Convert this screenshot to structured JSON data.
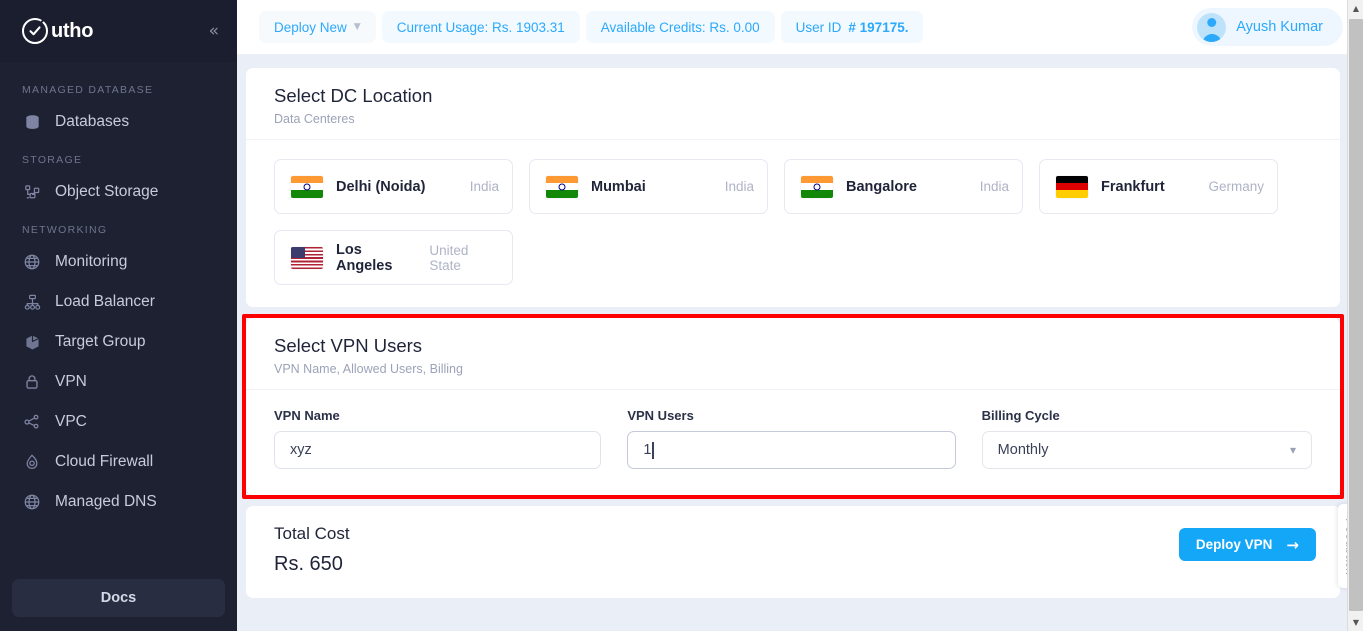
{
  "brand": {
    "name": "utho",
    "collapse_icon": "chevrons-left-icon",
    "logo_icon": "utho-check-logo"
  },
  "sidebar": {
    "groups": [
      {
        "label": "MANAGED DATABASE",
        "items": [
          {
            "label": "Databases",
            "icon": "database-icon"
          }
        ]
      },
      {
        "label": "STORAGE",
        "items": [
          {
            "label": "Object Storage",
            "icon": "object-storage-icon"
          }
        ]
      },
      {
        "label": "NETWORKING",
        "items": [
          {
            "label": "Monitoring",
            "icon": "globe-icon"
          },
          {
            "label": "Load Balancer",
            "icon": "load-balancer-icon"
          },
          {
            "label": "Target Group",
            "icon": "cube-icon"
          },
          {
            "label": "VPN",
            "icon": "lock-icon"
          },
          {
            "label": "VPC",
            "icon": "share-nodes-icon"
          },
          {
            "label": "Cloud Firewall",
            "icon": "firewall-flame-icon"
          },
          {
            "label": "Managed DNS",
            "icon": "globe-icon"
          }
        ]
      }
    ],
    "docs_label": "Docs"
  },
  "topbar": {
    "deploy_new": "Deploy New",
    "current_usage": "Current Usage: Rs. 1903.31",
    "available_credits": "Available Credits: Rs. 0.00",
    "user_id_prefix": "User ID ",
    "user_id_value": "# 197175.",
    "user_name": "Ayush Kumar",
    "accent": "#2ca9fb"
  },
  "dc_section": {
    "title": "Select DC Location",
    "subtitle": "Data Centeres",
    "locations": [
      {
        "city": "Delhi (Noida)",
        "country": "India",
        "flag": "flag-india"
      },
      {
        "city": "Mumbai",
        "country": "India",
        "flag": "flag-india"
      },
      {
        "city": "Bangalore",
        "country": "India",
        "flag": "flag-india"
      },
      {
        "city": "Frankfurt",
        "country": "Germany",
        "flag": "flag-germany"
      },
      {
        "city": "Los Angeles",
        "country": "United State",
        "flag": "flag-usa"
      }
    ]
  },
  "vpn_section": {
    "title": "Select VPN Users",
    "subtitle": "VPN Name, Allowed Users, Billing",
    "highlight_color": "#ff0000",
    "vpn_name_label": "VPN Name",
    "vpn_name_value": "xyz",
    "vpn_users_label": "VPN Users",
    "vpn_users_value": "1",
    "billing_label": "Billing Cycle",
    "billing_value": "Monthly",
    "billing_caret": "chevron-down-icon"
  },
  "total_section": {
    "label": "Total Cost",
    "value": "Rs. 650",
    "deploy_label": "Deploy VPN",
    "deploy_arrow": "arrow-right-icon",
    "deploy_color": "#14a6f7"
  },
  "feedback": {
    "label": "Feedback"
  },
  "scrollbar": {
    "up": "scroll-up-arrow",
    "down": "scroll-down-arrow"
  }
}
